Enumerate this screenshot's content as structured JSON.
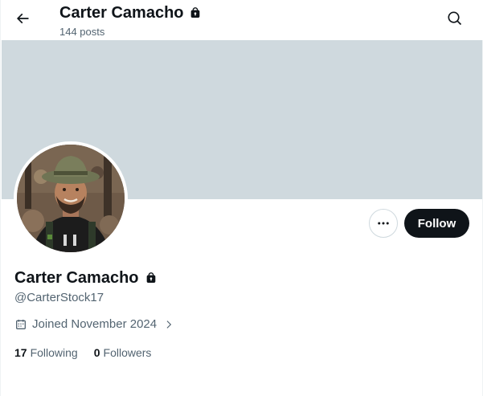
{
  "header": {
    "title": "Carter Camacho",
    "posts_count": "144 posts",
    "back_icon": "arrow-left-icon",
    "search_icon": "search-icon",
    "lock_icon": "lock-icon"
  },
  "banner": {
    "color": "#cfd9de"
  },
  "profile": {
    "name": "Carter Camacho",
    "handle": "@CarterStock17",
    "joined": "Joined November 2024",
    "following_count": "17",
    "following_label": "Following",
    "followers_count": "0",
    "followers_label": "Followers"
  },
  "actions": {
    "more_icon": "more-dots-icon",
    "follow_label": "Follow"
  },
  "colors": {
    "text_primary": "#0f1419",
    "text_secondary": "#536471",
    "follow_bg": "#0f1419"
  }
}
